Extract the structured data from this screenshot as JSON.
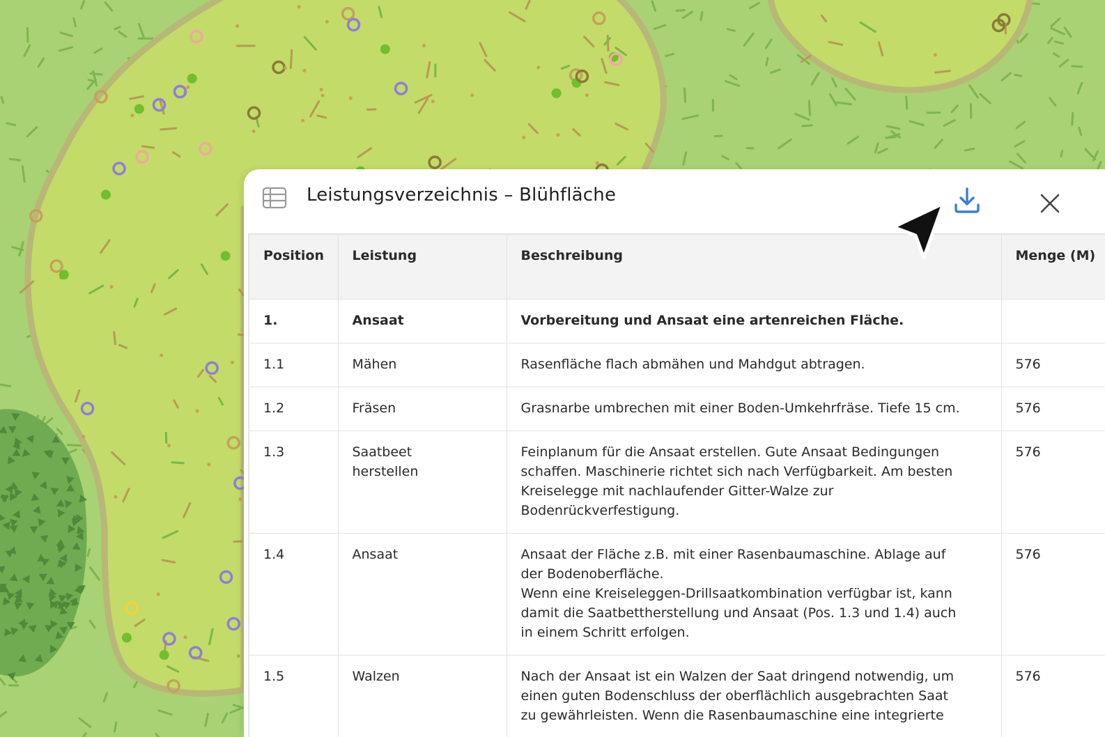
{
  "panel": {
    "title": "Leistungsverzeichnis – Blühfläche",
    "icons": {
      "table": "table-icon",
      "download": "download-icon",
      "close": "close-icon",
      "pointer": "cursor-arrow-icon"
    },
    "accent_color": "#3b7be0"
  },
  "table": {
    "headers": [
      "Position",
      "Leistung",
      "Beschreibung",
      "Menge (M)"
    ],
    "rows": [
      {
        "position": "1.",
        "leistung": "Ansaat",
        "beschreibung": "Vorbereitung und Ansaat eine artenreichen Fläche.",
        "menge": "",
        "bold": true
      },
      {
        "position": "1.1",
        "leistung": "Mähen",
        "beschreibung": "Rasenfläche flach abmähen und Mahdgut abtragen.",
        "menge": "576"
      },
      {
        "position": "1.2",
        "leistung": "Fräsen",
        "beschreibung": "Grasnarbe umbrechen mit einer Boden-Umkehrfräse. Tiefe 15 cm.",
        "menge": "576"
      },
      {
        "position": "1.3",
        "leistung": "Saatbeet\nherstellen",
        "beschreibung": "Feinplanum für die Ansaat erstellen. Gute Ansaat Bedingungen\nschaffen. Maschinerie richtet sich nach Verfügbarkeit. Am besten\nKreiselegge mit nachlaufender Gitter-Walze zur\nBodenrückverfestigung.",
        "menge": "576"
      },
      {
        "position": "1.4",
        "leistung": "Ansaat",
        "beschreibung": "Ansaat der Fläche z.B. mit einer Rasenbaumaschine. Ablage auf\nder Bodenoberfläche.\nWenn eine Kreiseleggen-Drillsaatkombination verfügbar ist, kann\ndamit die Saatbettherstellung und Ansaat  (Pos. 1.3 und 1.4) auch\nin einem Schritt erfolgen.",
        "menge": "576"
      },
      {
        "position": "1.5",
        "leistung": "Walzen",
        "beschreibung": "Nach der Ansaat ist ein Walzen der Saat dringend notwendig, um\neinen guten Bodenschluss der oberflächlich ausgebrachten Saat\nzu gewährleisten. Wenn die Rasenbaumaschine eine integrierte",
        "menge": "576"
      }
    ]
  },
  "map": {
    "colors": {
      "lawn": "#a8d273",
      "meadow": "#c3db68",
      "meadow_border": "#b9b777",
      "shrub": "#6fac51"
    }
  }
}
